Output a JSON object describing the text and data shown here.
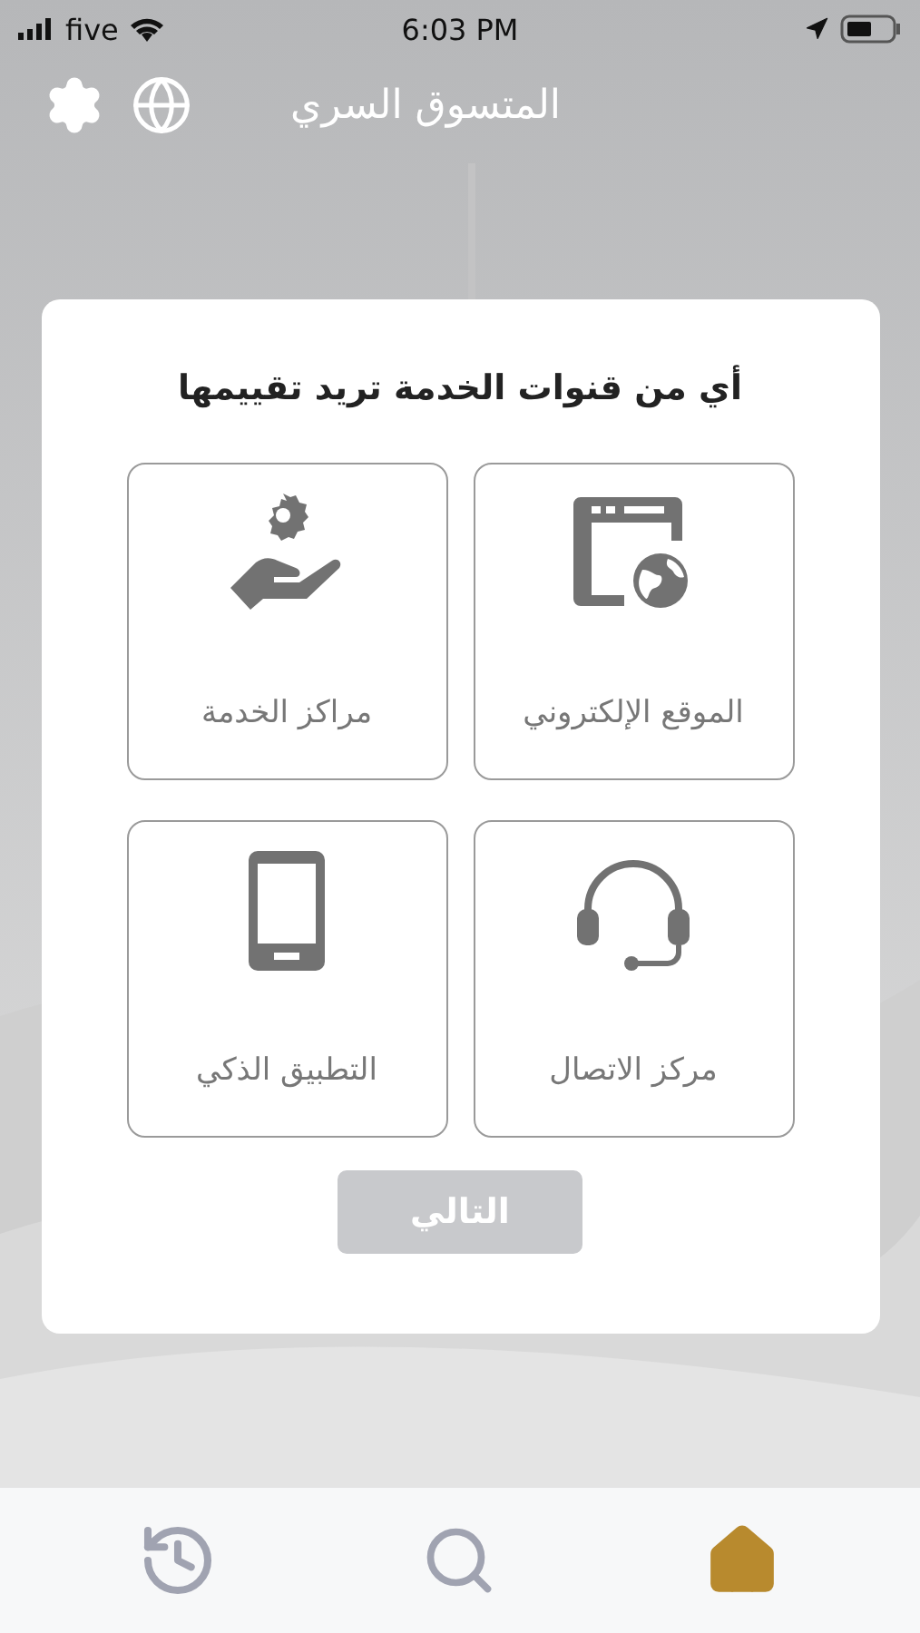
{
  "status_bar": {
    "carrier": "five",
    "time": "6:03 PM"
  },
  "header": {
    "title": "المتسوق السري"
  },
  "dialog": {
    "question": "أي من قنوات الخدمة تريد تقييمها",
    "options": [
      {
        "kind": "website",
        "label": "الموقع الإلكتروني",
        "selected": false
      },
      {
        "kind": "service",
        "label": "مراكز الخدمة",
        "selected": false
      },
      {
        "kind": "callcenter",
        "label": "مركز الاتصال",
        "selected": false
      },
      {
        "kind": "app",
        "label": "التطبيق الذكي",
        "selected": false
      }
    ],
    "next_button": {
      "label": "التالي",
      "disabled": true
    }
  },
  "tab_bar": [
    {
      "kind": "history",
      "selected": false
    },
    {
      "kind": "search",
      "selected": false
    },
    {
      "kind": "home",
      "selected": true
    }
  ]
}
